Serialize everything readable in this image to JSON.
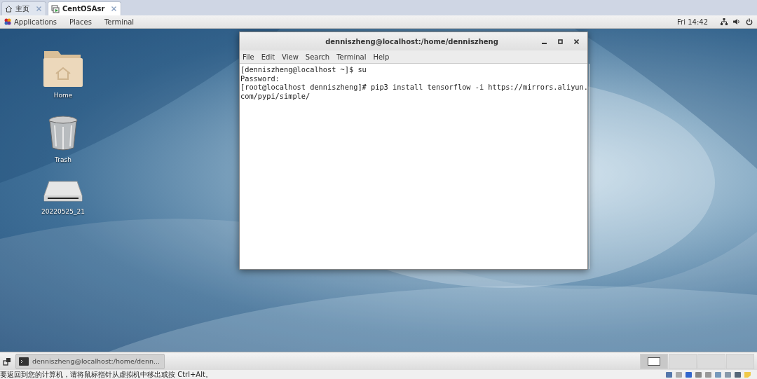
{
  "host_tabs": [
    {
      "label": "主页",
      "selected": false
    },
    {
      "label": "CentOSAsr",
      "selected": true
    }
  ],
  "top_bar": {
    "menus": [
      "Applications",
      "Places",
      "Terminal"
    ],
    "clock": "Fri 14:42"
  },
  "desktop_icons": [
    {
      "label": "Home",
      "kind": "folder"
    },
    {
      "label": "Trash",
      "kind": "trash"
    },
    {
      "label": "20220525_21",
      "kind": "drive"
    }
  ],
  "terminal": {
    "title": "denniszheng@localhost:/home/denniszheng",
    "menu": [
      "File",
      "Edit",
      "View",
      "Search",
      "Terminal",
      "Help"
    ],
    "lines": [
      "[denniszheng@localhost ~]$ su",
      "Password:",
      "[root@localhost denniszheng]# pip3 install tensorflow -i https://mirrors.aliyun.",
      "com/pypi/simple/"
    ]
  },
  "taskbar": {
    "window_button": "denniszheng@localhost:/home/denn...",
    "workspaces": [
      {
        "selected": true
      },
      {
        "selected": false
      },
      {
        "selected": false
      },
      {
        "selected": false
      }
    ]
  },
  "status_bar": {
    "message": "要返回到您的计算机，请将鼠标指针从虚拟机中移出或按 Ctrl+Alt。"
  }
}
